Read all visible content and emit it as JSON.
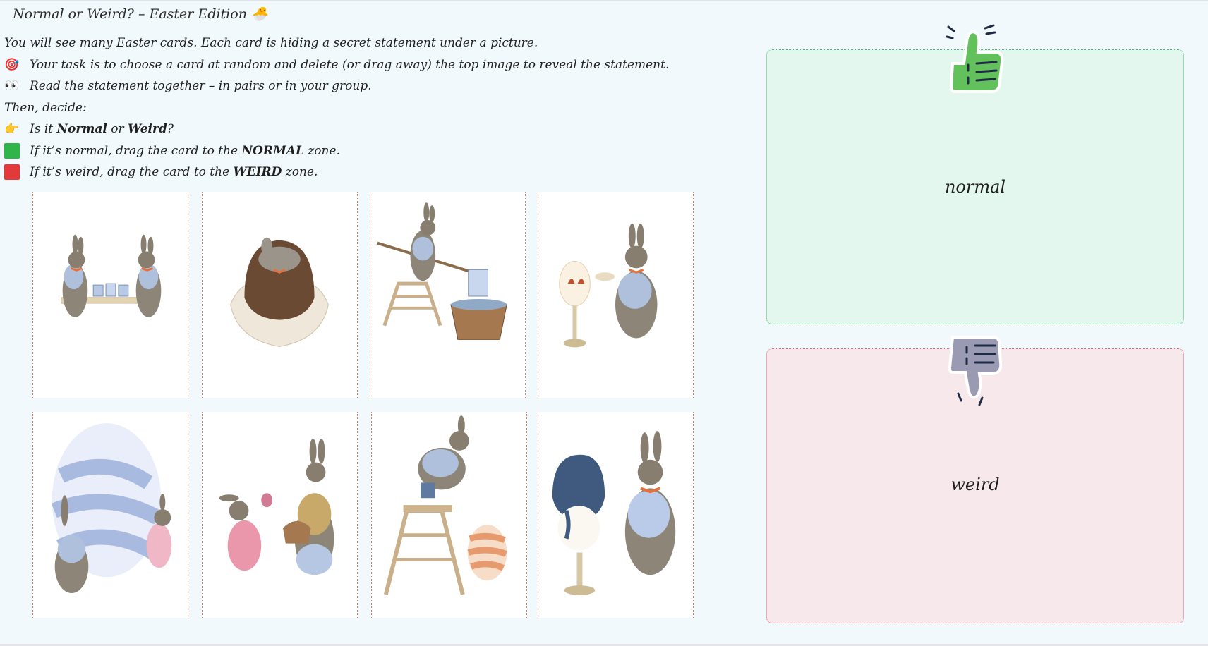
{
  "title": "Normal or Weird? – Easter Edition 🐣",
  "instructions": [
    {
      "icon": "",
      "parts": [
        {
          "t": "You will see many Easter cards. Each card is hiding a secret statement under a picture.",
          "b": false
        }
      ]
    },
    {
      "icon": "🎯",
      "parts": [
        {
          "t": "Your task is to choose a card at random and delete (or drag away) the top image to reveal the statement.",
          "b": false
        }
      ]
    },
    {
      "icon": "👀",
      "parts": [
        {
          "t": "Read the statement together – in pairs or in your group.",
          "b": false
        }
      ]
    },
    {
      "icon": "",
      "parts": [
        {
          "t": "Then, decide:",
          "b": false
        }
      ]
    },
    {
      "icon": "👉",
      "parts": [
        {
          "t": "Is it ",
          "b": false
        },
        {
          "t": "Normal",
          "b": true
        },
        {
          "t": " or ",
          "b": false
        },
        {
          "t": "Weird",
          "b": true
        },
        {
          "t": "?",
          "b": false
        }
      ]
    },
    {
      "icon": "green-square",
      "parts": [
        {
          "t": "If it’s normal, drag the card to the ",
          "b": false
        },
        {
          "t": "NORMAL",
          "b": true
        },
        {
          "t": " zone.",
          "b": false
        }
      ]
    },
    {
      "icon": "red-square",
      "parts": [
        {
          "t": "If it’s weird, drag the card to the ",
          "b": false
        },
        {
          "t": "WEIRD",
          "b": true
        },
        {
          "t": " zone.",
          "b": false
        }
      ]
    }
  ],
  "cards": [
    {
      "name": "card-bunnies-carrying-pots"
    },
    {
      "name": "card-bunny-in-chocolate-egg"
    },
    {
      "name": "card-bunny-on-ladder-dipping"
    },
    {
      "name": "card-bunny-painting-egg"
    },
    {
      "name": "card-bunny-striped-giant-egg"
    },
    {
      "name": "card-bunnies-basket-exchange"
    },
    {
      "name": "card-bunny-ladder-striped-egg"
    },
    {
      "name": "card-bunny-pouring-paint-egg"
    }
  ],
  "zones": {
    "normal_label": "normal",
    "weird_label": "weird"
  },
  "colors": {
    "thumb_up": "#63c15c",
    "thumb_down": "#9a9bb3",
    "green_square": "#2fb54a",
    "red_square": "#e23a3a"
  }
}
